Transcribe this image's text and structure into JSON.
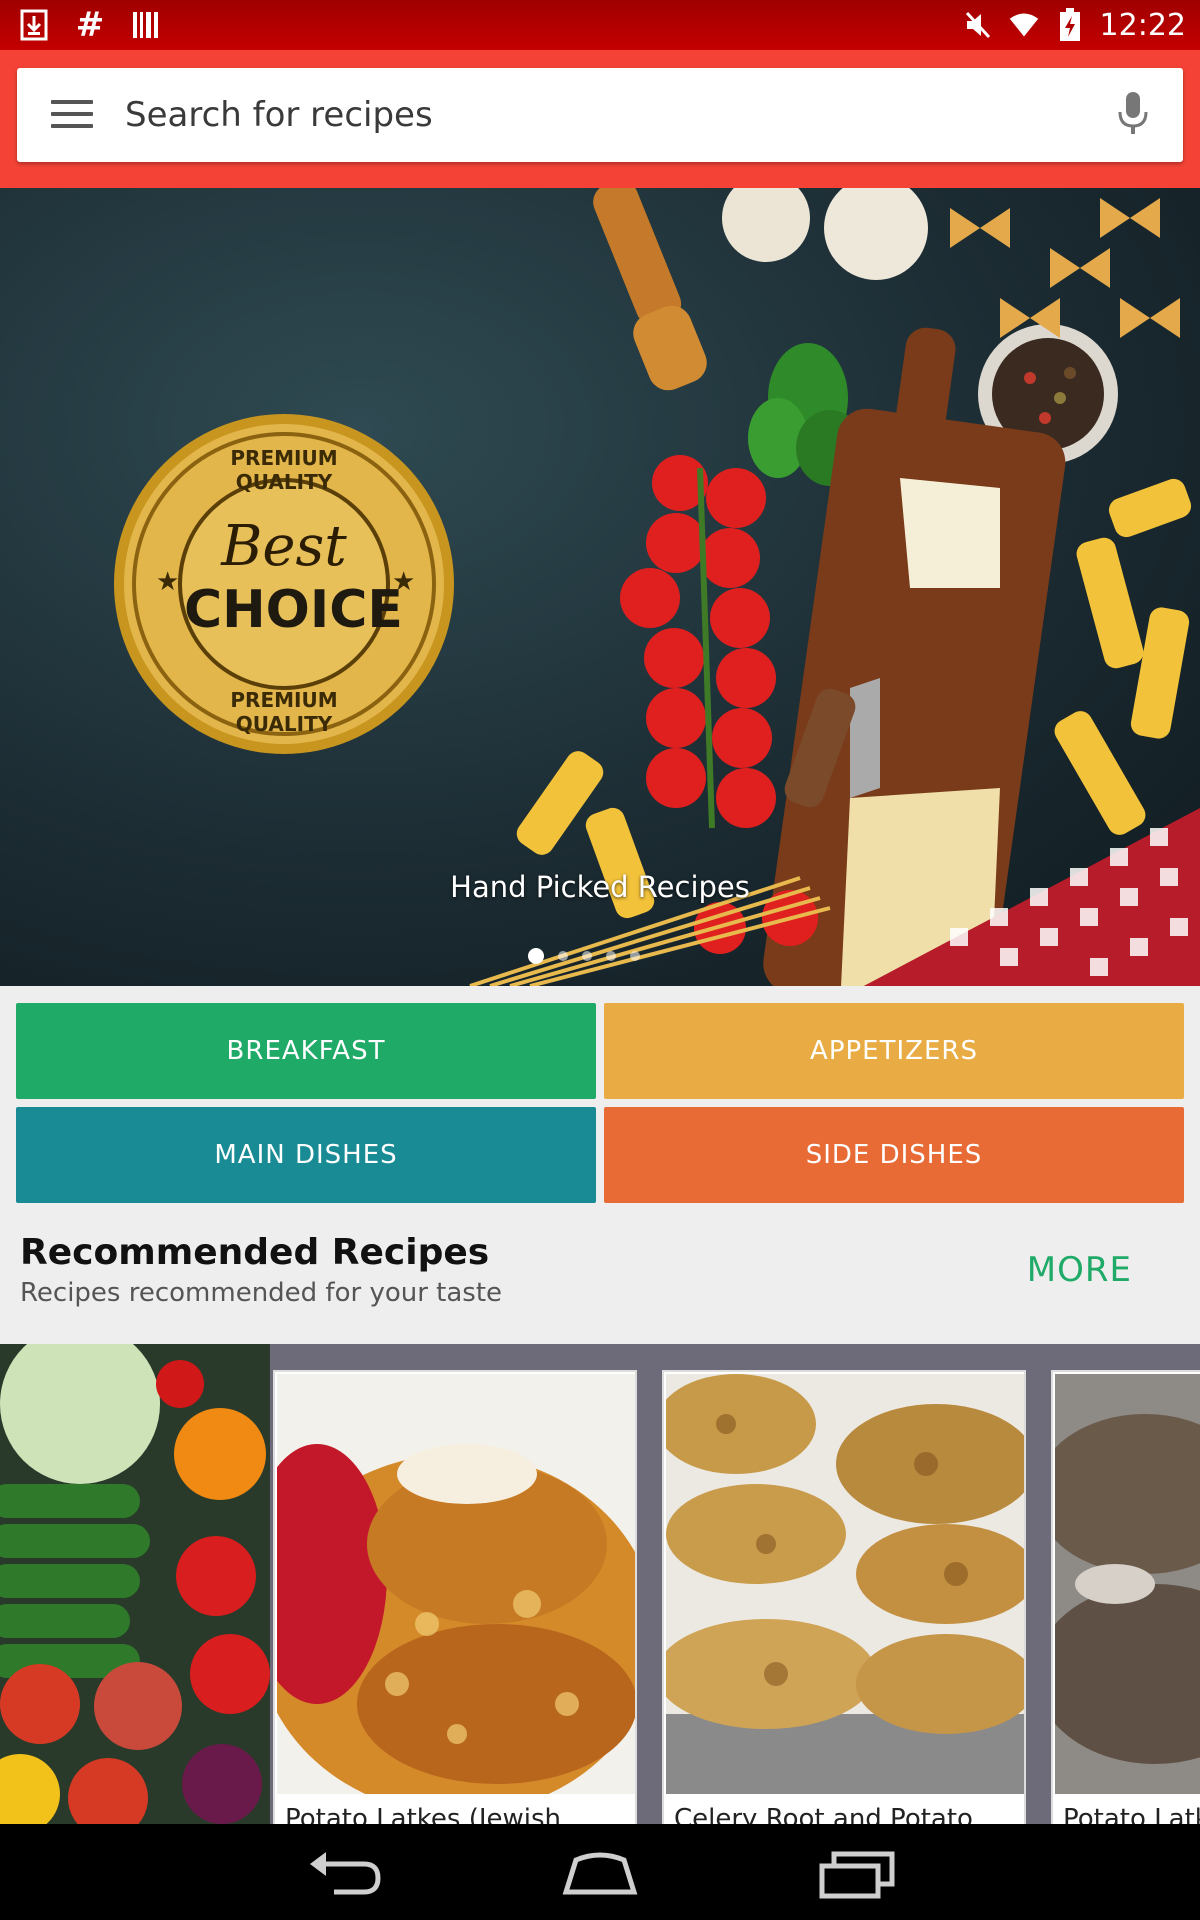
{
  "status_bar": {
    "time": "12:22",
    "icons": [
      "download-icon",
      "hashtag-icon",
      "barcode-icon",
      "mute-icon",
      "wifi-icon",
      "battery-icon"
    ]
  },
  "search": {
    "placeholder": "Search for recipes",
    "menu_icon": "hamburger-menu-icon",
    "mic_icon": "microphone-icon"
  },
  "hero": {
    "caption": "Hand Picked Recipes",
    "badge": {
      "line1": "PREMIUM QUALITY",
      "line2": "Best",
      "line3": "CHOICE",
      "line4": "PREMIUM QUALITY"
    },
    "page_count": 5,
    "active_page": 1
  },
  "categories": [
    {
      "label": "BREAKFAST",
      "color": "#1faa68"
    },
    {
      "label": "APPETIZERS",
      "color": "#e9ac44"
    },
    {
      "label": "MAIN DISHES",
      "color": "#198b95"
    },
    {
      "label": "SIDE DISHES",
      "color": "#e86a34"
    }
  ],
  "recommended": {
    "title": "Recommended Recipes",
    "subtitle": "Recipes recommended for your taste",
    "more_label": "MORE",
    "cards": [
      {
        "title": "Potato Latkes (Jewish"
      },
      {
        "title": "Celery Root and Potato"
      },
      {
        "title": "Potato Latk"
      }
    ]
  },
  "nav_bar": {
    "buttons": [
      "back-icon",
      "home-icon",
      "recents-icon"
    ]
  },
  "colors": {
    "status_bar": "#b00000",
    "header": "#f44336",
    "accent_green": "#1faa68"
  }
}
